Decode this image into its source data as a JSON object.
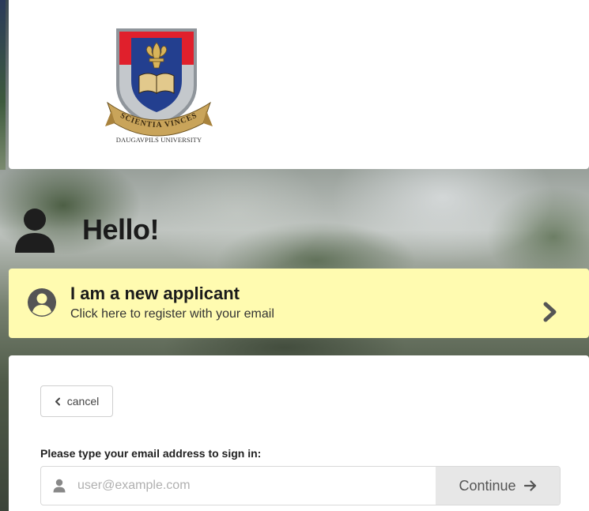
{
  "logo": {
    "motto": "SCIENTIA VINCES",
    "caption": "DAUGAVPILS UNIVERSITY",
    "icon": "university-crest"
  },
  "greeting": {
    "text": "Hello!",
    "icon": "person-silhouette-icon"
  },
  "applicant": {
    "title": "I am a new applicant",
    "subtitle": "Click here to register with your email",
    "icon": "user-circle-icon",
    "chevron": "chevron-right-icon"
  },
  "signin": {
    "cancel_label": "cancel",
    "cancel_icon": "chevron-left-icon",
    "prompt": "Please type your email address to sign in:",
    "email_placeholder": "user@example.com",
    "email_value": "",
    "email_icon": "user-icon",
    "continue_label": "Continue",
    "continue_icon": "arrow-right-icon"
  },
  "colors": {
    "applicant_bg": "#fffbb0",
    "crest_red": "#e0202c",
    "crest_blue": "#233f8f",
    "crest_gold": "#c9a45a",
    "continue_bg": "#e7e7e7"
  }
}
